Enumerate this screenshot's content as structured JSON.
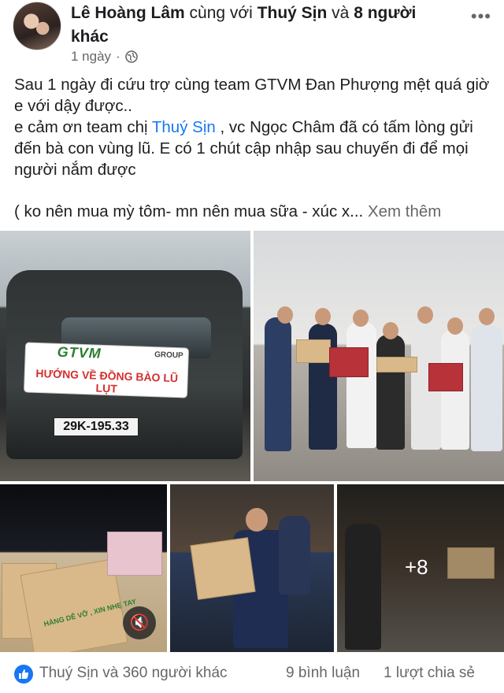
{
  "post": {
    "author": "Lê Hoàng Lâm",
    "with_word": " cùng với ",
    "tagged": "Thuý Sịn",
    "and_word": " và ",
    "others": "8 người khác",
    "time": "1 ngày",
    "dot": "·",
    "more": "•••",
    "text": {
      "line1": "Sau 1 ngày đi cứu trợ cùng team GTVM Đan Phượng mệt quá giờ e với dậy được..",
      "line2_prefix": "e cảm ơn team chị ",
      "line2_link": "Thuý Sịn",
      "line2_suffix": " , vc Ngọc Châm đã có tấm lòng gửi đến bà con vùng lũ. E có 1 chút cập nhập sau chuyến đi để mọi người nắm được",
      "line3": "( ko nên mua mỳ tôm- mn nên mua sữa - xúc x... ",
      "see_more": "Xem thêm"
    }
  },
  "photos": {
    "banner_brand": "GTVM",
    "banner_group": "GROUP",
    "banner_text": "HƯỚNG VỀ ĐỒNG BÀO LŨ LỤT",
    "plate": "29K-195.33",
    "box_label": "HÀNG DỄ VỠ , XIN NHẸ TAY",
    "more_count": "+8",
    "mute_icon": "speaker-muted-icon"
  },
  "footer": {
    "reactions": "Thuý Sịn và 360 người khác",
    "comments": "9 bình luận",
    "shares": "1 lượt chia sẻ"
  },
  "colors": {
    "link": "#1877f2",
    "secondary_text": "#65676b",
    "like_badge": "#1877f2"
  }
}
